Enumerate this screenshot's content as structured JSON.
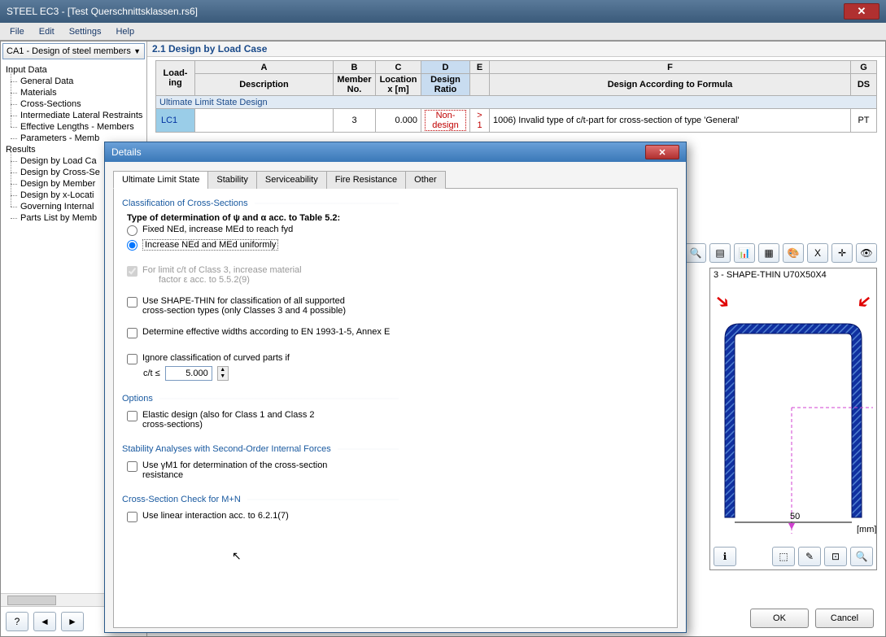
{
  "window": {
    "title": "STEEL EC3 - [Test Querschnittsklassen.rs6]"
  },
  "menu": [
    "File",
    "Edit",
    "Settings",
    "Help"
  ],
  "combo": "CA1 - Design of steel members",
  "tree": {
    "input": {
      "label": "Input Data",
      "items": [
        "General Data",
        "Materials",
        "Cross-Sections",
        "Intermediate Lateral Restraints",
        "Effective Lengths - Members",
        "Parameters - Memb"
      ]
    },
    "results": {
      "label": "Results",
      "items": [
        "Design by Load Ca",
        "Design by Cross-Se",
        "Design by Member",
        "Design by x-Locati",
        "Governing Internal",
        "Parts List by Memb"
      ]
    }
  },
  "section_header": "2.1 Design by Load Case",
  "grid": {
    "cols_top": [
      "",
      "A",
      "B",
      "C",
      "D",
      "E",
      "F",
      "G"
    ],
    "cols": [
      "Load-\ning",
      "Description",
      "Member\nNo.",
      "Location\nx [m]",
      "Design\nRatio",
      "",
      "Design According to Formula",
      "DS"
    ],
    "group_row": "Ultimate Limit State Design",
    "row": {
      "loading": "LC1",
      "desc": "",
      "member": "3",
      "x": "0.000",
      "ratio": "Non-design",
      "gt": "> 1",
      "formula": "1006) Invalid type of c/t-part for cross-section of type 'General'",
      "ds": "PT"
    }
  },
  "preview": {
    "title": "3 - SHAPE-THIN U70X50X4",
    "dim": "50",
    "unit": "[mm]"
  },
  "dialog": {
    "title": "Details",
    "tabs": [
      "Ultimate Limit State",
      "Stability",
      "Serviceability",
      "Fire Resistance",
      "Other"
    ],
    "g1": {
      "title": "Classification of Cross-Sections",
      "type_label": "Type of determination of ψ and α acc. to Table 5.2:",
      "r1": "Fixed NEd, increase MEd to reach fyd",
      "r2": "Increase NEd and MEd uniformly",
      "cb1a": "For limit c/t of Class 3, increase material",
      "cb1b": "factor ε acc. to 5.5.2(9)",
      "cb2a": "Use SHAPE-THIN for classification of all supported",
      "cb2b": "cross-section types (only Classes 3 and 4 possible)",
      "cb3": "Determine effective widths according to EN 1993-1-5, Annex E",
      "cb4": "Ignore classification of curved parts if",
      "ct_label": "c/t ≤",
      "ct_value": "5.000"
    },
    "g2": {
      "title": "Options",
      "cb1a": "Elastic design (also for Class 1 and Class 2",
      "cb1b": "cross-sections)"
    },
    "g3": {
      "title": "Stability Analyses with Second-Order Internal Forces",
      "cb1a": "Use γM1 for determination of the cross-section",
      "cb1b": "resistance"
    },
    "g4": {
      "title": "Cross-Section Check for M+N",
      "cb1": "Use linear interaction acc. to 6.2.1(7)"
    }
  },
  "buttons": {
    "ok": "OK",
    "cancel": "Cancel"
  }
}
